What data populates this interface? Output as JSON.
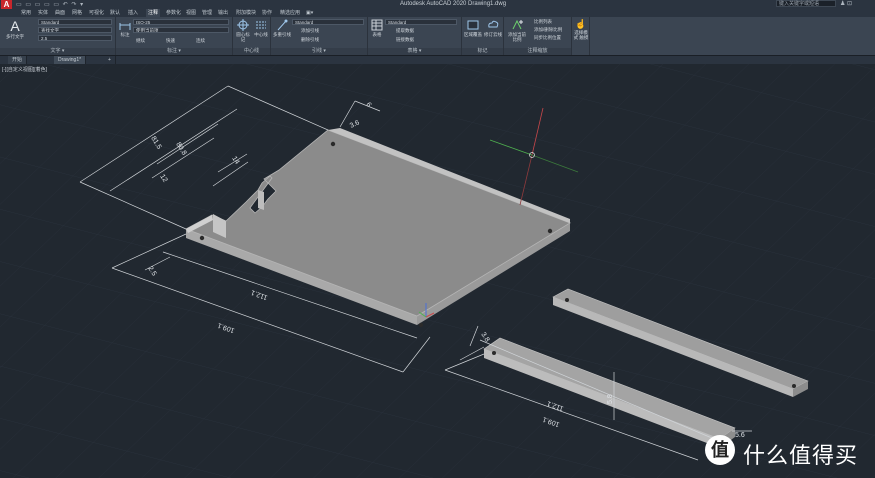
{
  "titlebar": {
    "app_logo": "A",
    "qat": "▭ ▭ ▭ ▭ ▭ ↶ ↷ ▾",
    "document_title": "Autodesk AutoCAD 2020    Drawing1.dwg",
    "search_placeholder": "键入关键字或短语",
    "right": "♟ ⊡"
  },
  "ribbon_tabs": [
    "默认",
    "插入",
    "注释",
    "参数化",
    "视图",
    "管理",
    "输出",
    "附加模块",
    "协作",
    "精选应用",
    "▣▾"
  ],
  "ribbon_tabs_extra": [
    "常用",
    "实体",
    "曲面",
    "网格",
    "可视化"
  ],
  "active_tab_index": 2,
  "ribbon": {
    "text_panel": {
      "title": "文字 ▾",
      "big_button": "多行文字",
      "style": "Standard",
      "find": "查找文字",
      "height": "2.5"
    },
    "dim_panel": {
      "title": "标注 ▾",
      "big_button": "标注",
      "style": "ISO-25",
      "layer": "使用当前项",
      "row3a": "继续",
      "row3b": "快速",
      "row3c": "连续"
    },
    "center_panel": {
      "title": "中心线",
      "btn1": "圆心标记",
      "btn2": "中心线"
    },
    "leader_panel": {
      "title": "引线 ▾",
      "big_button": "多重引线",
      "style": "Standard",
      "add": "添加引线",
      "remove": "删除引线"
    },
    "table_panel": {
      "title": "表格 ▾",
      "big_button": "表格",
      "style": "Standard",
      "extract": "提取数据",
      "link": "链接数据"
    },
    "markup_panel": {
      "title": "标记",
      "btn1": "区域覆盖",
      "btn2": "修订云线"
    },
    "scale_panel": {
      "title": "注释缩放",
      "big_button": "添加当前比例",
      "btn1": "比例列表",
      "btn2": "添加/删除比例",
      "btn3": "同步比例位置"
    },
    "select_panel": {
      "title": "",
      "big_button": "选择模式 触摸"
    }
  },
  "doc_tabs": [
    "开始",
    "Drawing1*",
    "+"
  ],
  "viewport_label": "[-][自定义视图][着色]",
  "dimensions": {
    "d1": "81.5",
    "d2": "80.8",
    "d3": "12",
    "d4": "14",
    "d5": "6",
    "d6": "3.6",
    "d7": "2.5",
    "d8": "112.1",
    "d9": "109.1",
    "d10": "3.8",
    "d11": "112.1",
    "d12": "109.1",
    "d13": "5.8",
    "d14": "5.6"
  },
  "watermark": {
    "logo": "值",
    "text": "什么值得买"
  },
  "colors": {
    "background": "#212830",
    "model": "#8c8c8c",
    "ucs_x": "#c8474a",
    "ucs_y": "#4fb04f",
    "ucs_z": "#4a6fd8"
  }
}
